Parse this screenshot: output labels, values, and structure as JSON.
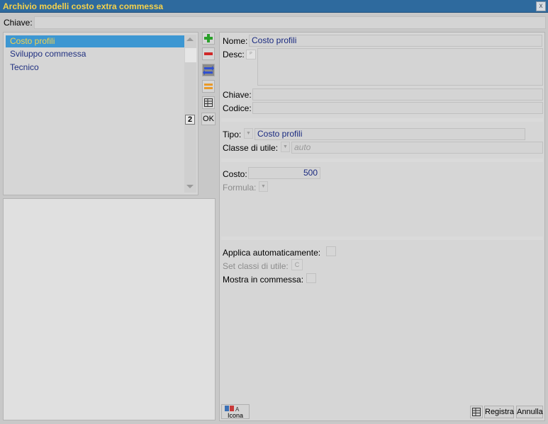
{
  "window": {
    "title": "Archivio modelli costo extra commessa",
    "close": "x"
  },
  "search": {
    "label": "Chiave:",
    "value": ""
  },
  "list": {
    "items": [
      "Costo profili",
      "Sviluppo commessa",
      "Tecnico"
    ],
    "selected_index": 0,
    "counter": "2"
  },
  "toolbar": {
    "add": "add",
    "remove": "remove",
    "swap": "swap",
    "equal": "equal",
    "grid": "grid",
    "ok": "OK"
  },
  "form": {
    "nome_label": "Nome:",
    "nome_value": "Costo profili",
    "desc_label": "Desc:",
    "desc_flag": "ᴾ",
    "chiave_label": "Chiave:",
    "codice_label": "Codice:",
    "tipo_label": "Tipo:",
    "tipo_value": "Costo profili",
    "classe_label": "Classe di utile:",
    "classe_value": "auto",
    "costo_label": "Costo:",
    "costo_value": "500",
    "formula_label": "Formula:",
    "applica_label": "Applica automaticamente:",
    "setclassi_label": "Set classi di utile:",
    "setclassi_btn": "C",
    "mostra_label": "Mostra in commessa:"
  },
  "footer": {
    "icona_label": "Icona",
    "registra": "Registra",
    "annulla": "Annulla"
  }
}
